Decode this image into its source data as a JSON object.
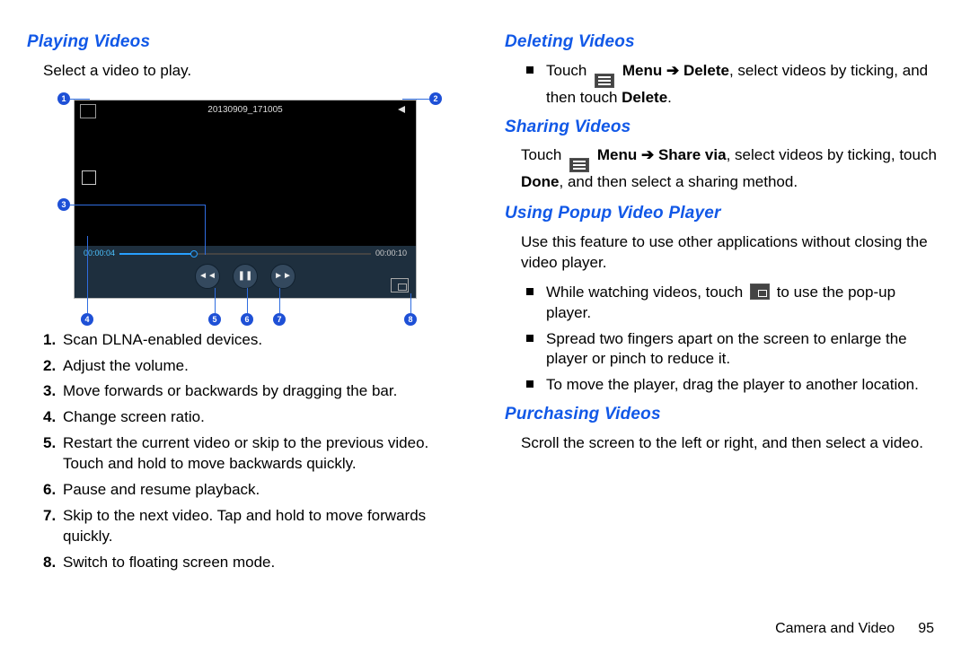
{
  "left": {
    "h1": "Playing Videos",
    "intro": "Select a video to play.",
    "video": {
      "title": "20130909_171005",
      "elapsed": "00:00:04",
      "total": "00:00:10"
    },
    "callouts": [
      "1",
      "2",
      "3",
      "4",
      "5",
      "6",
      "7",
      "8"
    ],
    "list": [
      "Scan DLNA-enabled devices.",
      "Adjust the volume.",
      "Move forwards or backwards by dragging the bar.",
      "Change screen ratio.",
      "Restart the current video or skip to the previous video. Touch and hold to move backwards quickly.",
      "Pause and resume playback.",
      "Skip to the next video. Tap and hold to move forwards quickly.",
      "Switch to floating screen mode."
    ]
  },
  "right": {
    "del_h": "Deleting Videos",
    "del_pre": "Touch",
    "del_menu": "Menu",
    "del_arrow": "➔",
    "del_action": "Delete",
    "del_post": ", select videos by ticking, and then touch",
    "del_final": "Delete",
    "share_h": "Sharing Videos",
    "share_pre": "Touch",
    "share_menu": "Menu",
    "share_arrow": "➔",
    "share_action": "Share via",
    "share_post": ", select videos by ticking, touch",
    "share_done": "Done",
    "share_final": ", and then select a sharing method.",
    "popup_h": "Using Popup Video Player",
    "popup_intro": "Use this feature to use other applications without closing the video player.",
    "popup_b1a": "While watching videos, touch",
    "popup_b1b": "to use the pop-up player.",
    "popup_b2": "Spread two fingers apart on the screen to enlarge the player or pinch to reduce it.",
    "popup_b3": "To move the player, drag the player to another location.",
    "purch_h": "Purchasing Videos",
    "purch_p": "Scroll the screen to the left or right, and then select a video."
  },
  "footer": {
    "chapter": "Camera and Video",
    "page": "95"
  }
}
